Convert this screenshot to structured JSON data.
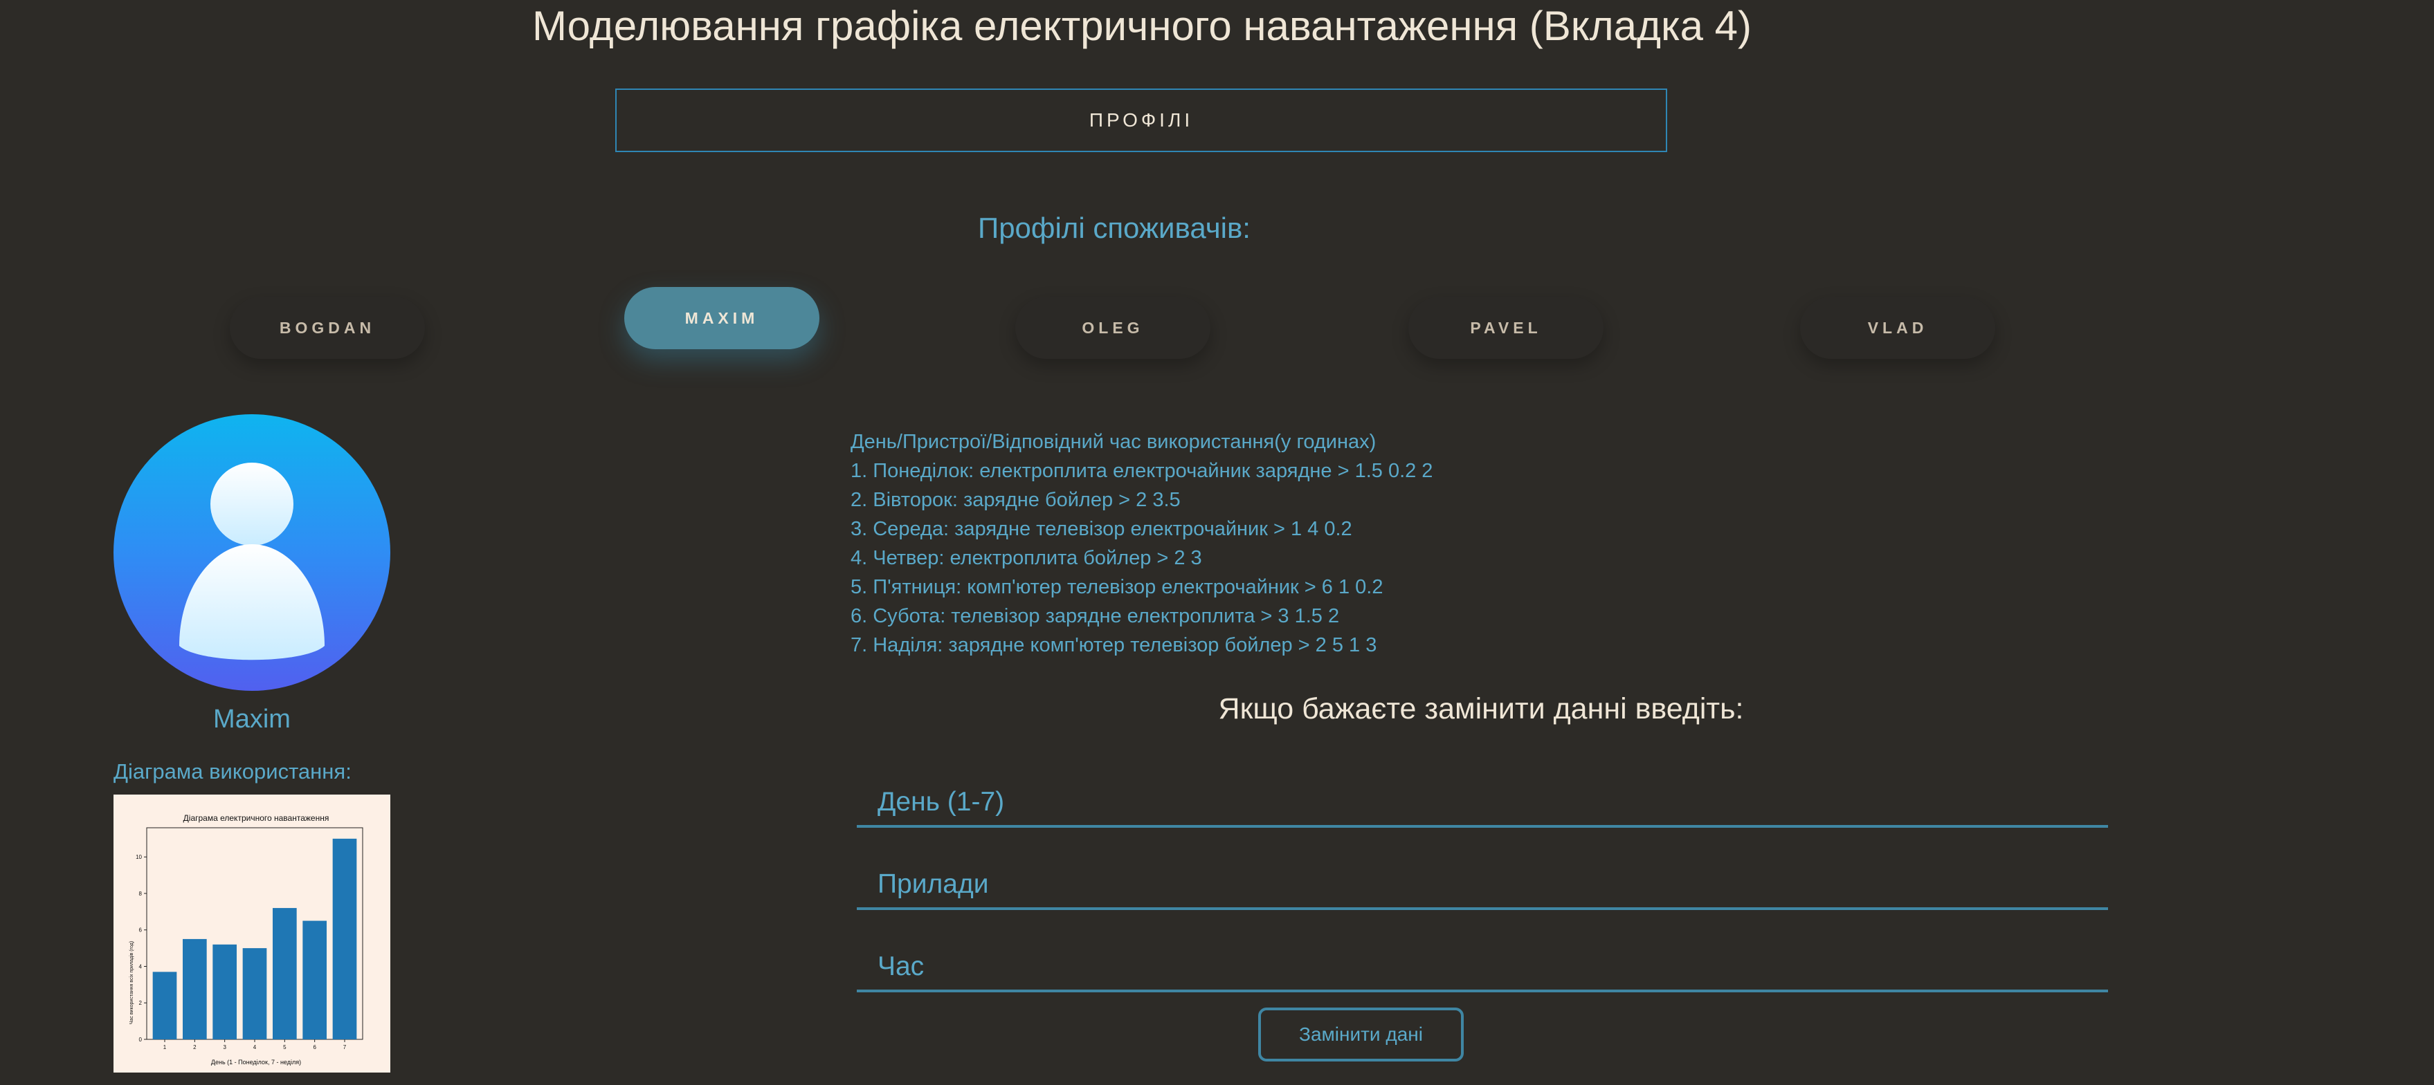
{
  "header": {
    "title": "Моделювання графіка електричного навантаження (Вкладка 4)",
    "profiles_button": "ПРОФІЛІ"
  },
  "profiles": {
    "heading": "Профілі споживачів:",
    "users": [
      {
        "label": "BOGDAN",
        "active": false
      },
      {
        "label": "MAXIM",
        "active": true
      },
      {
        "label": "OLEG",
        "active": false
      },
      {
        "label": "PAVEL",
        "active": false
      },
      {
        "label": "VLAD",
        "active": false
      }
    ]
  },
  "user": {
    "avatar_icon": "user-avatar-icon",
    "name": "Maxim",
    "usage_label": "Діаграма використання:"
  },
  "schedule": {
    "header": "День/Пристрої/Відповідний час використання(у годинах)",
    "lines": [
      "1. Понеділок: електроплита електрочайник зарядне > 1.5 0.2 2",
      "2. Вівторок: зарядне бойлер > 2 3.5",
      "3. Середа: зарядне телевізор електрочайник > 1 4 0.2",
      "4. Четвер: електроплита бойлер > 2 3",
      "5. П'ятниця: комп'ютер телевізор електрочайник > 6 1 0.2",
      "6. Субота: телевізор зарядне електроплита > 3 1.5 2",
      "7. Наділя: зарядне комп'ютер телевізор бойлер > 2 5 1 3"
    ]
  },
  "form": {
    "heading": "Якщо бажаєте замінити данні введіть:",
    "day_placeholder": "День (1-7)",
    "devices_placeholder": "Прилади",
    "time_placeholder": "Час",
    "submit_label": "Замінити дані"
  },
  "chart_data": {
    "type": "bar",
    "title": "Діаграма електричного навантаження",
    "xlabel": "День (1 - Понеділок, 7 - неділя)",
    "ylabel": "Час використання всіх приладів (год)",
    "categories": [
      "1",
      "2",
      "3",
      "4",
      "5",
      "6",
      "7"
    ],
    "values": [
      3.7,
      5.5,
      5.2,
      5.0,
      7.2,
      6.5,
      11.0
    ],
    "yticks": [
      "0",
      "2",
      "4",
      "6",
      "8",
      "10"
    ],
    "ylim": [
      0,
      11.6
    ],
    "bar_color": "#1f77b4",
    "grid": false,
    "legend": "none"
  }
}
